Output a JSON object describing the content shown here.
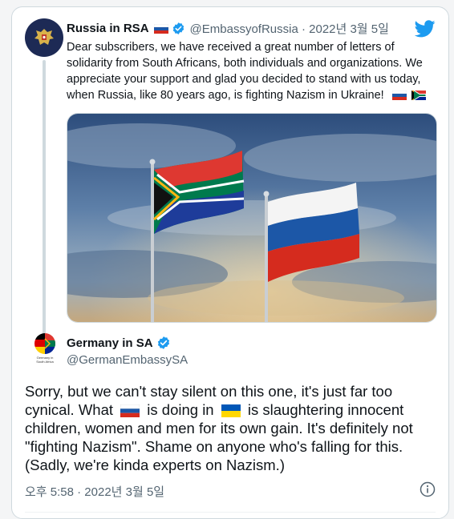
{
  "quoted_tweet": {
    "display_name": "Russia in RSA",
    "handle_and_date": "@EmbassyofRussia · 2022년 3월 5일",
    "text": "Dear subscribers, we have received a great number of letters of solidarity from South Africans, both individuals and organizations. We appreciate your support and glad you decided to stand with us today, when Russia, like 80 years ago, is fighting Nazism in Ukraine!",
    "name_flag_icon": "flag-russia-icon",
    "end_flag_icons": [
      "flag-russia-icon",
      "flag-south-africa-icon"
    ],
    "photo_description_icon": "flags-photo"
  },
  "main_tweet": {
    "display_name": "Germany in SA",
    "handle": "@GermanEmbassySA",
    "avatar_caption_line1": "Germany in",
    "avatar_caption_line2": "South Africa",
    "text_parts": [
      "Sorry, but we can't stay silent on this one, it's just far too cynical. What",
      "is doing in",
      "is slaughtering innocent children, women and men for its own gain. It's definitely not \"fighting Nazism\". Shame on anyone who's falling for this. (Sadly, we're kinda experts on Nazism.)"
    ],
    "inline_flag_icons": [
      "flag-russia-icon",
      "flag-ukraine-icon"
    ],
    "timestamp": "오후 5:58 · 2022년 3월 5일"
  },
  "colors": {
    "twitter_blue": "#1d9bf0",
    "verified_blue": "#1d9bf0",
    "secondary_text": "#536471",
    "russian_avatar_bg": "#1d2a55"
  }
}
